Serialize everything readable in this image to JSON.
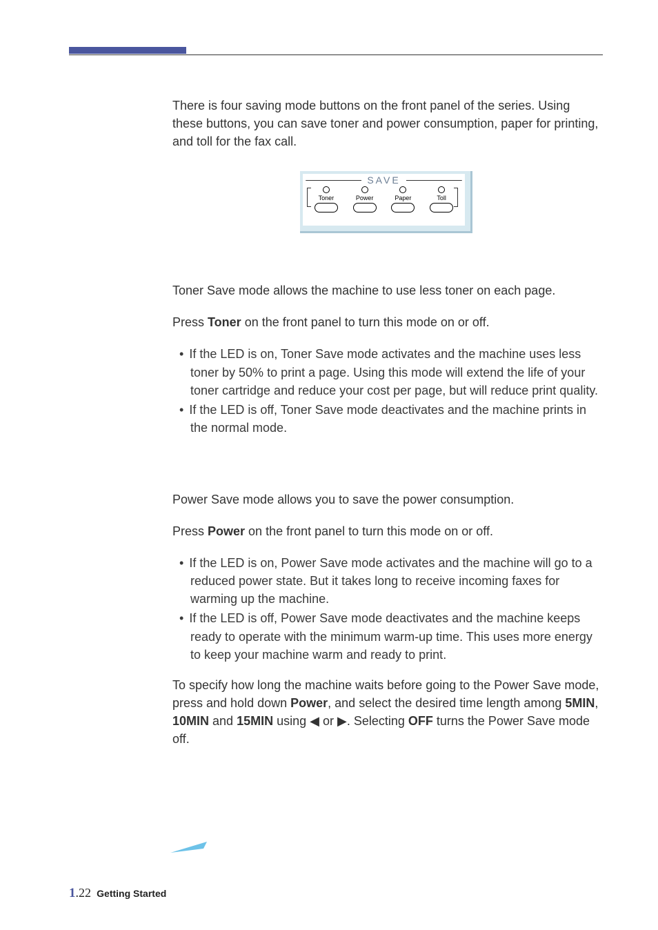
{
  "intro": "There is four saving mode buttons on the front panel of the series. Using these buttons, you can save toner and power consumption, paper for printing, and toll for the fax call.",
  "diagram": {
    "title": "SAVE",
    "buttons": [
      "Toner",
      "Power",
      "Paper",
      "Toll"
    ]
  },
  "toner": {
    "p1": "Toner Save mode allows the machine to use less toner on each page.",
    "p2_pre": "Press ",
    "p2_btn": "Toner",
    "p2_post": " on the front panel  to turn this mode on or off.",
    "bullets": [
      "If the LED is on, Toner Save mode activates and the machine uses less toner by 50% to print a page. Using this mode will extend the life of your toner cartridge and reduce your cost per page, but will reduce print quality.",
      "If the LED is off, Toner Save mode deactivates and the machine prints in the normal mode."
    ]
  },
  "power": {
    "p1": "Power Save mode allows you to save the power consumption.",
    "p2_pre": "Press ",
    "p2_btn": "Power",
    "p2_post": " on the front panel  to turn this mode on or off.",
    "bullets": [
      "If the LED is on, Power Save mode activates and the machine will go to a reduced power state. But it takes long to receive incoming faxes for warming up the machine.",
      "If the LED is off, Power Save mode deactivates and the machine keeps ready to operate with the minimum warm-up time. This uses more energy to keep your machine warm and ready to print."
    ],
    "p3_a": "To specify how long the machine waits before going to the Power Save mode, press and hold down ",
    "p3_power": "Power",
    "p3_b": ", and select the desired time length among ",
    "p3_5": "5MIN",
    "p3_c": ", ",
    "p3_10": "10MIN",
    "p3_d": " and ",
    "p3_15": "15MIN",
    "p3_e": " using ",
    "p3_left": "➛",
    "p3_f": " or ",
    "p3_right": "❿",
    "p3_g": ". Selecting ",
    "p3_off": "OFF",
    "p3_h": " turns the Power Save mode off."
  },
  "footer": {
    "chapter": "1",
    "page": ".22",
    "section": "Getting Started"
  }
}
